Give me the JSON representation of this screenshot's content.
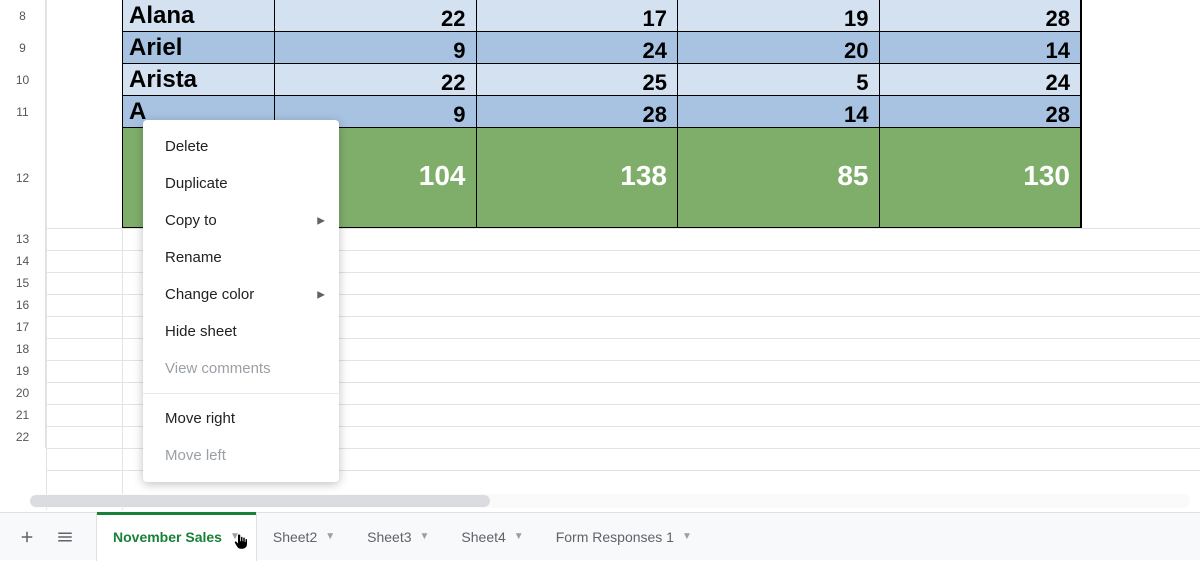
{
  "rows": {
    "r8": {
      "num": "8",
      "name": "Alana",
      "c1": "22",
      "c2": "17",
      "c3": "19",
      "c4": "28"
    },
    "r9": {
      "num": "9",
      "name": "Ariel",
      "c1": "9",
      "c2": "24",
      "c3": "20",
      "c4": "14"
    },
    "r10": {
      "num": "10",
      "name": "Arista",
      "c1": "22",
      "c2": "25",
      "c3": "5",
      "c4": "24"
    },
    "r11": {
      "num": "11",
      "name": "A",
      "c1": "9",
      "c2": "28",
      "c3": "14",
      "c4": "28"
    }
  },
  "totals": {
    "c1": "104",
    "c2": "138",
    "c3": "85",
    "c4": "130"
  },
  "rowheaders": {
    "r12": "12",
    "r13": "13",
    "r14": "14",
    "r15": "15",
    "r16": "16",
    "r17": "17",
    "r18": "18",
    "r19": "19",
    "r20": "20",
    "r21": "21",
    "r22": "22"
  },
  "menu": {
    "delete": "Delete",
    "duplicate": "Duplicate",
    "copyto": "Copy to",
    "rename": "Rename",
    "changecolor": "Change color",
    "hide": "Hide sheet",
    "viewcomments": "View comments",
    "moveright": "Move right",
    "moveleft": "Move left"
  },
  "tabs": {
    "active": "November Sales",
    "t2": "Sheet2",
    "t3": "Sheet3",
    "t4": "Sheet4",
    "t5": "Form Responses 1"
  },
  "colors": {
    "light": "#d3e1f1",
    "mid": "#a8c3e2",
    "green": "#7fae6b"
  }
}
